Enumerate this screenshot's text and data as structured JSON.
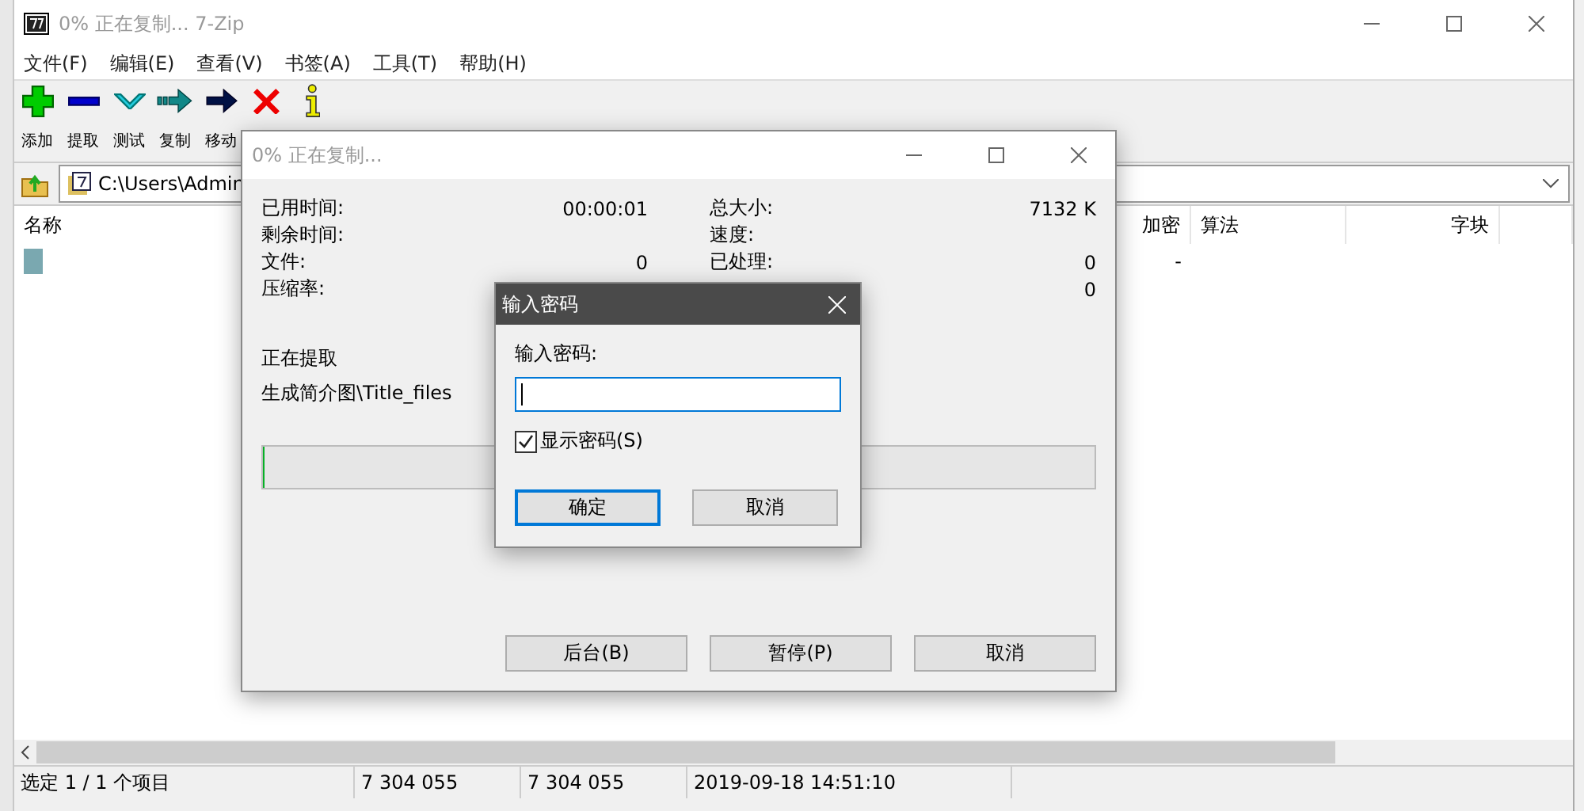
{
  "main_window": {
    "title": "0% 正在复制... 7-Zip",
    "menu": [
      "文件(F)",
      "编辑(E)",
      "查看(V)",
      "书签(A)",
      "工具(T)",
      "帮助(H)"
    ],
    "toolbar": [
      {
        "kind": "add",
        "label": "添加"
      },
      {
        "kind": "extract",
        "label": "提取"
      },
      {
        "kind": "test",
        "label": "测试"
      },
      {
        "kind": "copy",
        "label": "复制"
      },
      {
        "kind": "move",
        "label": "移动"
      },
      {
        "kind": "delete"
      },
      {
        "kind": "info"
      }
    ],
    "address": "C:\\Users\\Admin",
    "columns": [
      "名称",
      "加密",
      "算法",
      "字块"
    ],
    "rows": [
      {
        "encrypted": "-"
      }
    ],
    "status_bar": [
      "选定 1 / 1 个项目",
      "7 304 055",
      "7 304 055",
      "2019-09-18 14:51:10"
    ]
  },
  "progress_dialog": {
    "title": "0% 正在复制...",
    "left_stats": [
      {
        "label": "已用时间:",
        "value": "00:00:01"
      },
      {
        "label": "剩余时间:"
      },
      {
        "label": "文件:",
        "value": "0"
      },
      {
        "label": "压缩率:"
      }
    ],
    "right_stats": [
      {
        "label": "总大小:",
        "value": "7132 K"
      },
      {
        "label": "速度:"
      },
      {
        "label": "已处理:",
        "value": "0"
      },
      {
        "value": "0"
      }
    ],
    "operation": "正在提取",
    "current_file": "生成简介图\\Title_files",
    "progress": {
      "level": 0
    },
    "buttons": [
      "后台(B)",
      "暂停(P)",
      "取消"
    ]
  },
  "password_dialog": {
    "title": "输入密码",
    "prompt": "输入密码:",
    "show_password": {
      "label": "显示密码(S)",
      "checked": true
    },
    "buttons": [
      {
        "label": "确定",
        "default": true
      },
      {
        "label": "取消",
        "default": false
      }
    ]
  }
}
